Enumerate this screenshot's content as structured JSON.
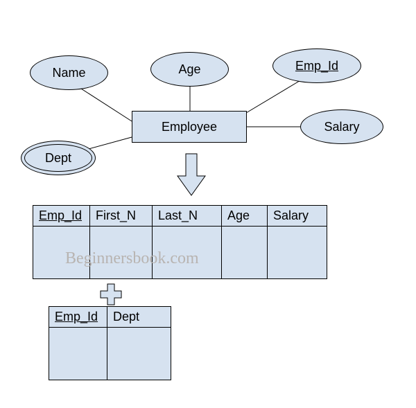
{
  "entity": {
    "label": "Employee"
  },
  "attributes": {
    "name": "Name",
    "age": "Age",
    "emp_id": "Emp_Id",
    "salary": "Salary",
    "dept": "Dept"
  },
  "table1": {
    "headers": [
      "Emp_Id",
      "First_N",
      "Last_N",
      "Age",
      "Salary"
    ]
  },
  "table2": {
    "headers": [
      "Emp_Id",
      "Dept"
    ]
  },
  "watermark": "Beginnersbook.com"
}
